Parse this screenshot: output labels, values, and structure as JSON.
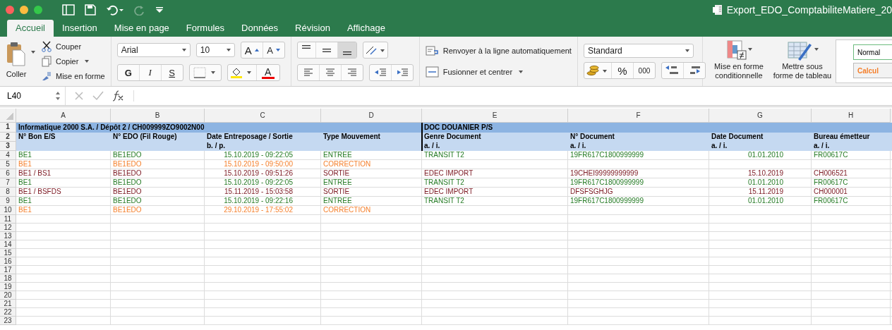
{
  "window": {
    "title": "Export_EDO_ComptabiliteMatiere_20"
  },
  "tabs": [
    {
      "label": "Accueil",
      "selected": true
    },
    {
      "label": "Insertion",
      "selected": false
    },
    {
      "label": "Mise en page",
      "selected": false
    },
    {
      "label": "Formules",
      "selected": false
    },
    {
      "label": "Données",
      "selected": false
    },
    {
      "label": "Révision",
      "selected": false
    },
    {
      "label": "Affichage",
      "selected": false
    }
  ],
  "clipboard": {
    "paste": "Coller",
    "cut": "Couper",
    "copy": "Copier",
    "format": "Mise en forme"
  },
  "font": {
    "name": "Arial",
    "size": "10",
    "grow": "A",
    "shrink": "A",
    "bold": "G",
    "italic": "I",
    "underline": "S",
    "color_letter": "A"
  },
  "alignment": {
    "wrap": "Renvoyer à la ligne automatiquement",
    "merge": "Fusionner et centrer"
  },
  "number": {
    "format": "Standard",
    "percent": "%",
    "thousands": "000"
  },
  "styles": {
    "conditional": "Mise en forme conditionnelle",
    "table": "Mettre sous forme de tableau",
    "cell_styles": [
      {
        "label": "Normal",
        "kind": "normal"
      },
      {
        "label": "Calcul",
        "kind": "calc"
      }
    ]
  },
  "formula_bar": {
    "cell_ref": "L40"
  },
  "sheet": {
    "columns": [
      "A",
      "B",
      "C",
      "D",
      "E",
      "F",
      "G",
      "H"
    ],
    "group_row": {
      "number": "1",
      "left": "Informatique 2000 S.A. / Dépôt 2 / CH009999ZO9002N00",
      "right": "DOC DOUANIER P/S"
    },
    "header_rows": [
      {
        "number": "2",
        "cells": [
          "N° Bon E/S",
          "N° EDO (Fil Rouge)",
          "Date Entreposage / Sortie",
          "Type Mouvement",
          "Genre Document",
          "N° Document",
          "Date Document",
          "Bureau émetteur"
        ]
      },
      {
        "number": "3",
        "cells": [
          "",
          "",
          "b. / p.",
          "",
          "a. / i.",
          "a. / i.",
          "a. / i.",
          "a. / i."
        ]
      }
    ],
    "rows": [
      {
        "number": "4",
        "color": "#237a23",
        "cells": [
          "BE1",
          "BE1EDO",
          "15.10.2019 - 09:22:05",
          "ENTREE",
          "TRANSIT T2",
          "19FR617C1800999999",
          "01.01.2010",
          "FR00617C"
        ]
      },
      {
        "number": "5",
        "color": "#f57f2a",
        "cells": [
          "BE1",
          "BE1EDO",
          "15.10.2019 - 09:50:00",
          "CORRECTION",
          "",
          "",
          "",
          ""
        ]
      },
      {
        "number": "6",
        "color": "#7b1620",
        "cells": [
          "BE1 / BS1",
          "BE1EDO",
          "15.10.2019 - 09:51:26",
          "SORTIE",
          "EDEC IMPORT",
          "19CHEI99999999999",
          "15.10.2019",
          "CH006521"
        ]
      },
      {
        "number": "7",
        "color": "#237a23",
        "cells": [
          "BE1",
          "BE1EDO",
          "15.10.2019 - 09:22:05",
          "ENTREE",
          "TRANSIT T2",
          "19FR617C1800999999",
          "01.01.2010",
          "FR00617C"
        ]
      },
      {
        "number": "8",
        "color": "#7b1620",
        "cells": [
          "BE1 / BSFDS",
          "BE1EDO",
          "15.11.2019 - 15:03:58",
          "SORTIE",
          "EDEC IMPORT",
          "DFSFSGHJG",
          "15.11.2019",
          "CH000001"
        ]
      },
      {
        "number": "9",
        "color": "#237a23",
        "cells": [
          "BE1",
          "BE1EDO",
          "15.10.2019 - 09:22:16",
          "ENTREE",
          "TRANSIT T2",
          "19FR617C1800999999",
          "01.01.2010",
          "FR00617C"
        ]
      },
      {
        "number": "10",
        "color": "#f57f2a",
        "cells": [
          "BE1",
          "BE1EDO",
          "29.10.2019 - 17:55:02",
          "CORRECTION",
          "",
          "",
          "",
          ""
        ]
      }
    ],
    "empty_rows": [
      "11",
      "12",
      "13",
      "14",
      "15",
      "16",
      "17",
      "18",
      "19",
      "20",
      "21",
      "22",
      "23"
    ]
  }
}
